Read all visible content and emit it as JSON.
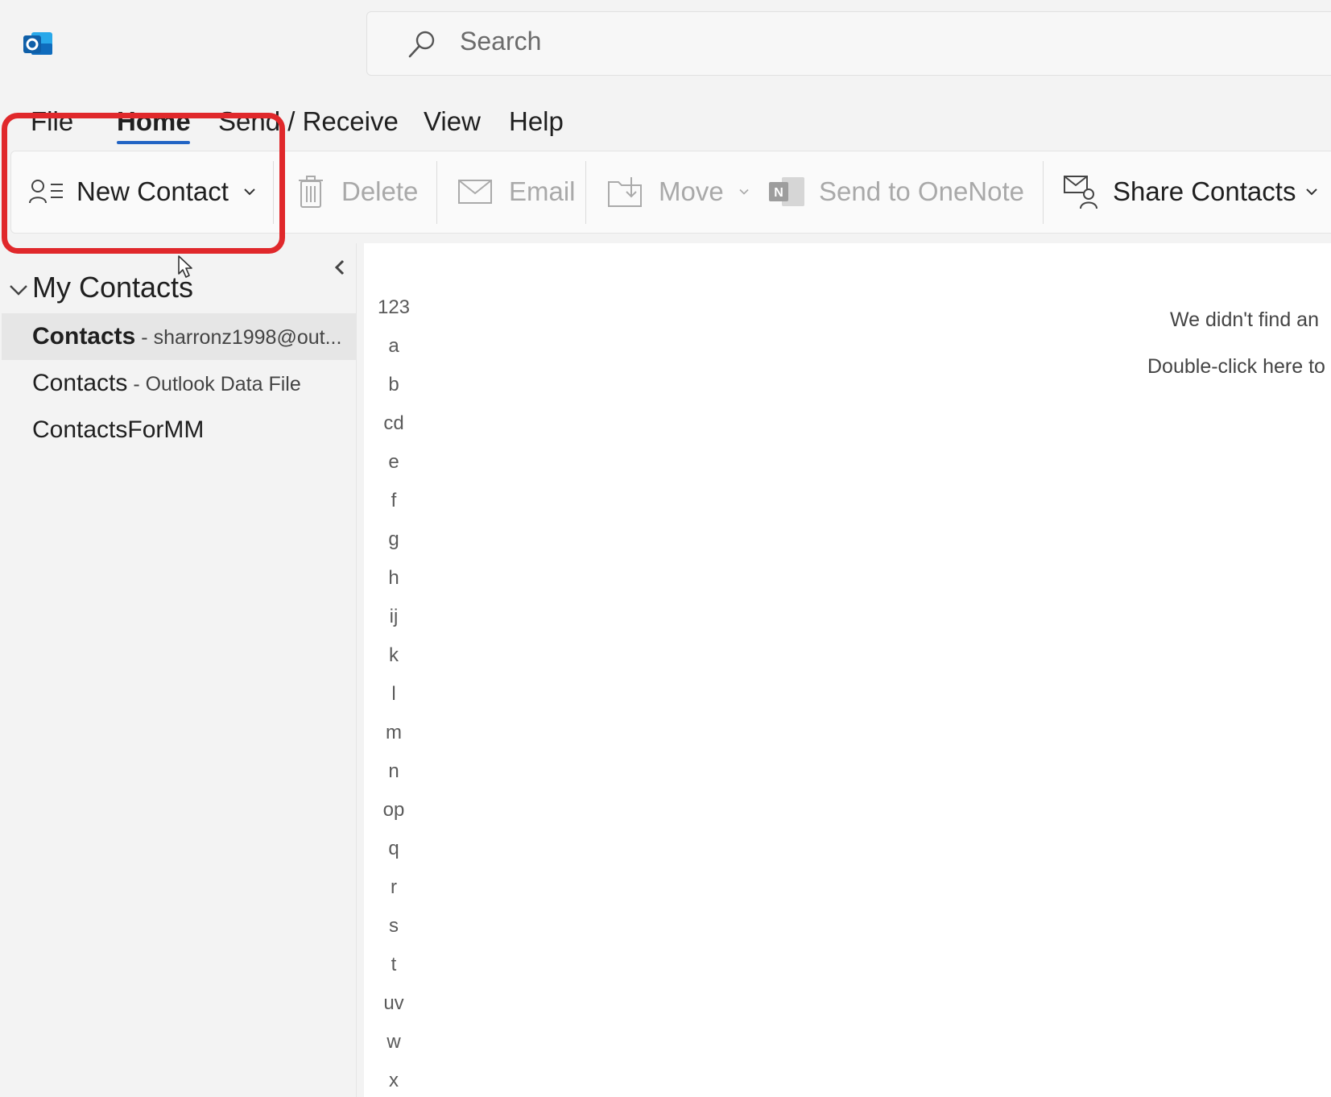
{
  "search": {
    "placeholder": "Search"
  },
  "menu": {
    "tabs": [
      "File",
      "Home",
      "Send / Receive",
      "View",
      "Help"
    ],
    "active": "Home"
  },
  "ribbon": {
    "new_contact": "New Contact",
    "delete": "Delete",
    "email": "Email",
    "move": "Move",
    "send_to_onenote": "Send to OneNote",
    "share_contacts": "Share Contacts"
  },
  "sidebar": {
    "group_label": "My Contacts",
    "folders": [
      {
        "name": "Contacts",
        "sub": "sharronz1998@out...",
        "selected": true
      },
      {
        "name": "Contacts",
        "sub": "Outlook Data File",
        "selected": false
      },
      {
        "name": "ContactsForMM",
        "sub": "",
        "selected": false
      }
    ]
  },
  "index_letters": [
    "123",
    "a",
    "b",
    "cd",
    "e",
    "f",
    "g",
    "h",
    "ij",
    "k",
    "l",
    "m",
    "n",
    "op",
    "q",
    "r",
    "s",
    "t",
    "uv",
    "w",
    "x"
  ],
  "empty_message": {
    "line1": "We didn't find an",
    "line2": "Double-click here to"
  },
  "colors": {
    "accent": "#2264c4",
    "highlight": "#e0282b",
    "outlook_blue": "#0f6cbd"
  }
}
